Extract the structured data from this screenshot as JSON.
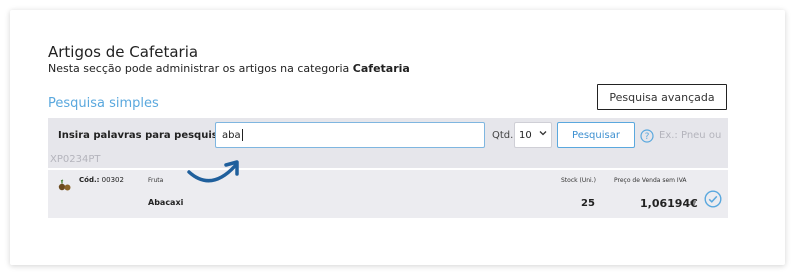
{
  "header": {
    "title": "Artigos de Cafetaria",
    "subtitle_prefix": "Nesta secção pode administrar os artigos na categoria ",
    "subtitle_category": "Cafetaria"
  },
  "search": {
    "simple_link": "Pesquisa simples",
    "advanced_button": "Pesquisa avançada",
    "label": "Insira palavras para pesquisar",
    "value": "aba",
    "qty_label": "Qtd.",
    "qty_value": "10",
    "submit_button": "Pesquisar",
    "example_text": "Ex.: Pneu ou",
    "example_text_cont": "XP0234PT"
  },
  "results": [
    {
      "code_label": "Cód.:",
      "code": "00302",
      "family": "Fruta",
      "name": "Abacaxi",
      "stock_label": "Stock (Uni.)",
      "stock": "25",
      "price_label": "Preço de Venda sem IVA",
      "price": "1,06194€"
    }
  ],
  "colors": {
    "accent": "#5aa8de",
    "search_bar_bg": "#e6e6eb",
    "row_bg": "#ececf0",
    "arrow": "#1f5f9c"
  },
  "icons": {
    "help": "help-circle-icon",
    "product": "product-icon",
    "select": "checkmark-circle-icon",
    "qty_dropdown": "chevron-down-icon",
    "pointer": "curved-arrow-icon"
  }
}
